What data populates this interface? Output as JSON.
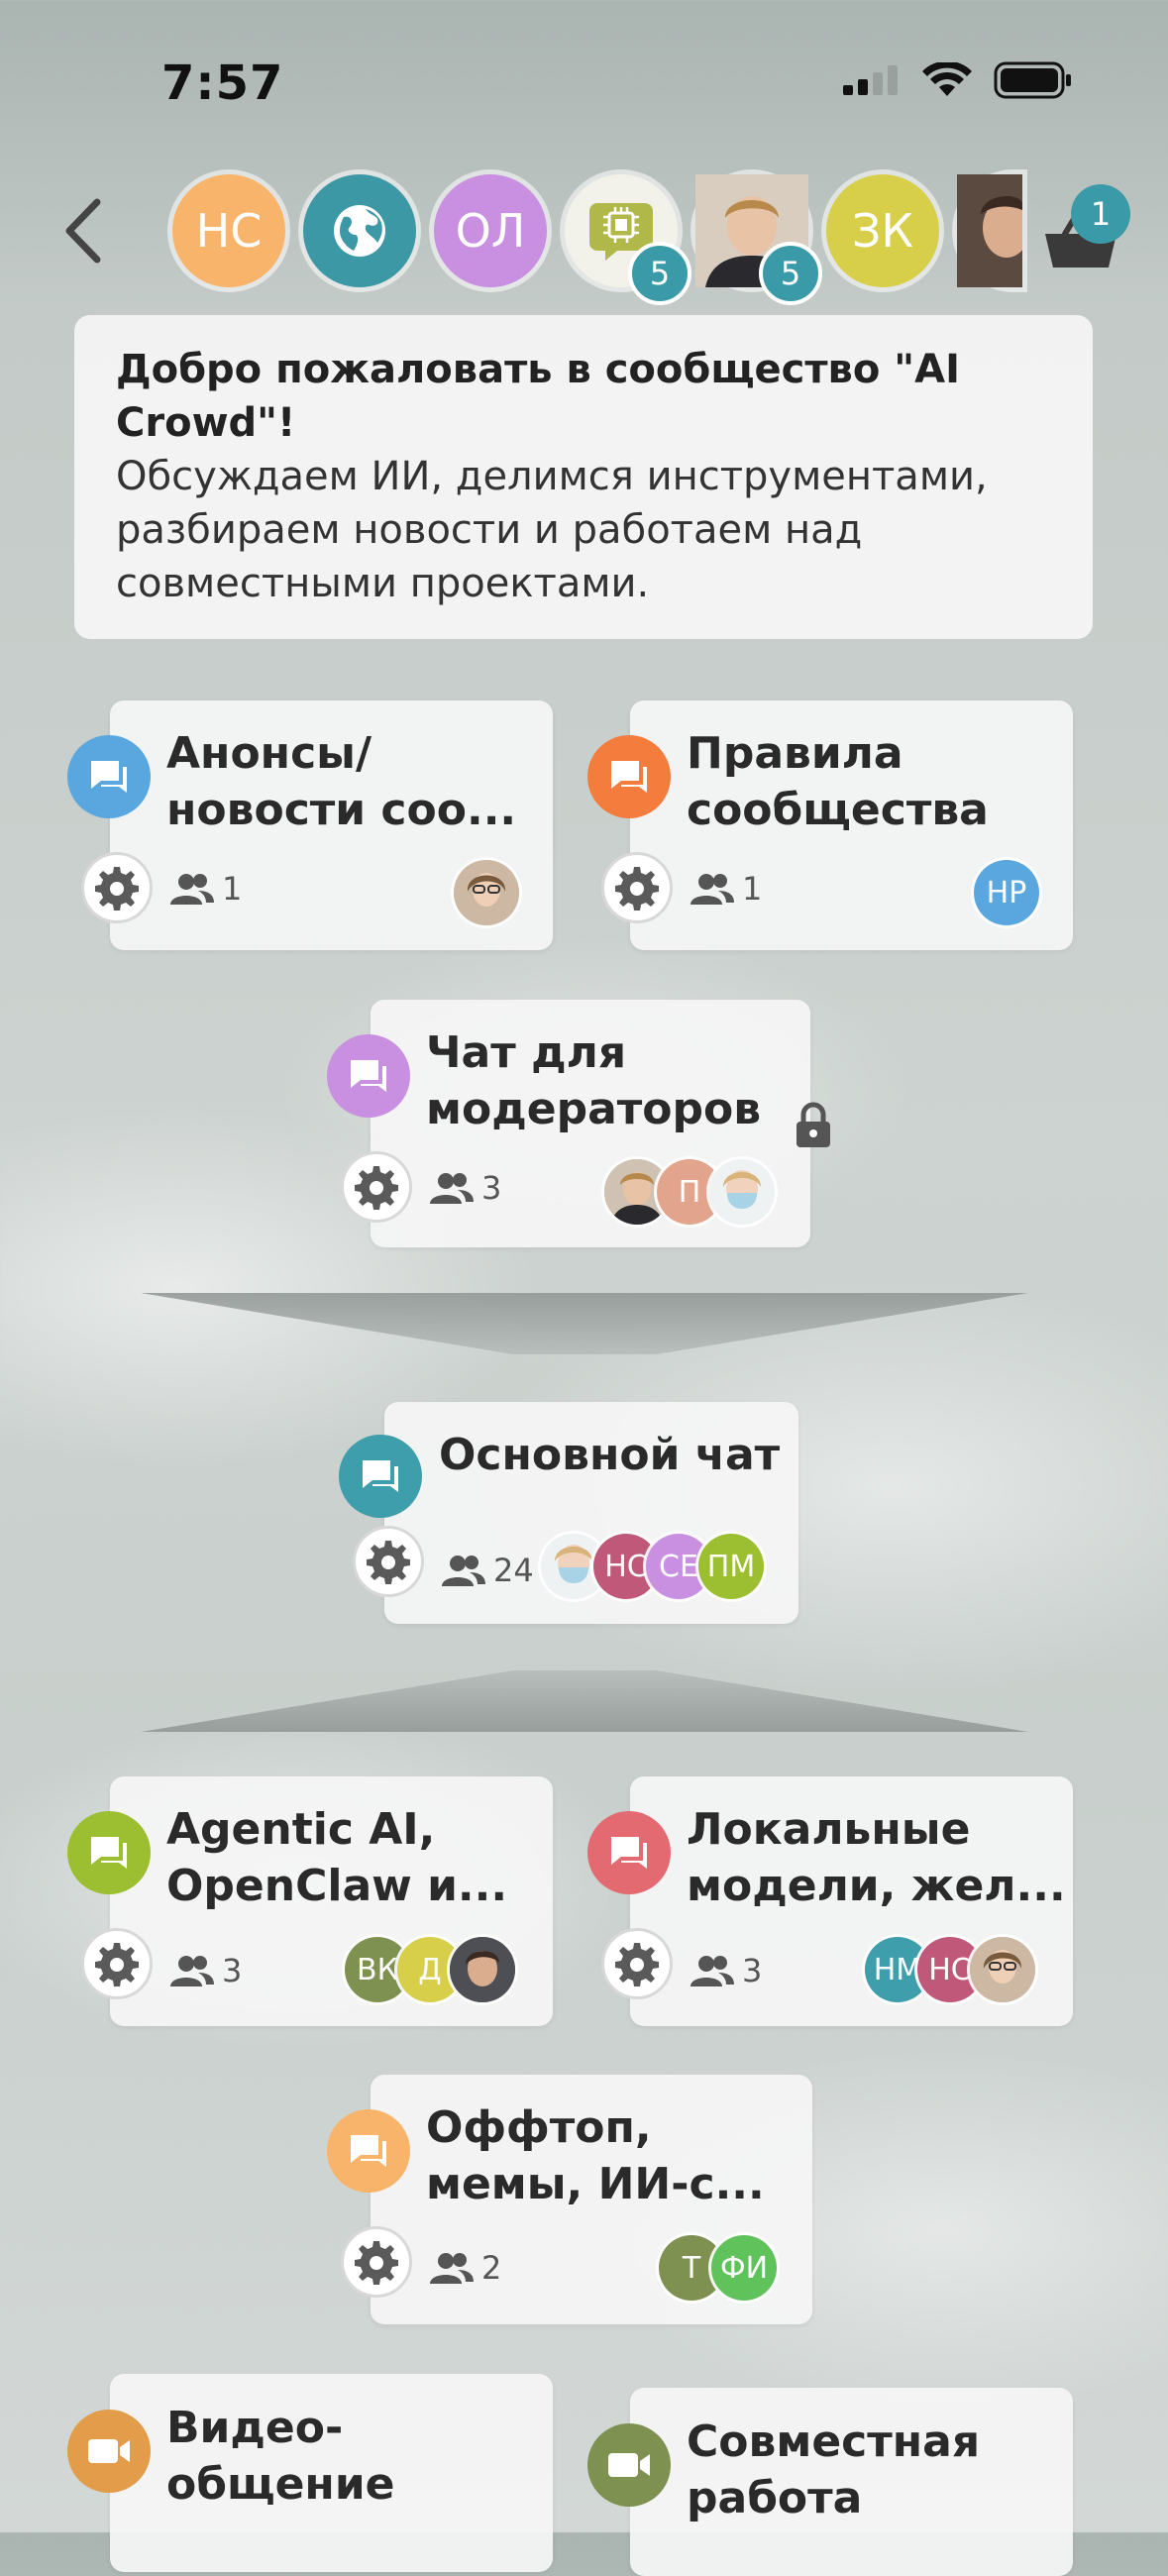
{
  "status_bar": {
    "time": "7:57"
  },
  "top_bar": {
    "chips": [
      {
        "label": "НС",
        "color": "#f9b46b"
      },
      {
        "label": "",
        "color": "#3d98a6",
        "icon": "globe-icon"
      },
      {
        "label": "ОЛ",
        "color": "#c98fe0"
      },
      {
        "label": "",
        "color": "#f2f2ea",
        "icon": "ai-chip-icon",
        "badge": "5"
      },
      {
        "label": "",
        "color": "#c9b9a6",
        "icon": "person-photo",
        "badge": "5"
      },
      {
        "label": "ЗК",
        "color": "#d7cf4a"
      },
      {
        "label": "",
        "color": "#8a7566",
        "icon": "person-photo"
      }
    ],
    "cart_badge": "1"
  },
  "welcome": {
    "title": "Добро пожаловать в сообщество \"AI Crowd\"!",
    "text": "Обсуждаем ИИ, делимся инструментами, разбираем новости и работаем над совместными проектами."
  },
  "channels": {
    "announcements": {
      "title_line1": "Анонсы/",
      "title_line2": "новости соо...",
      "members": "1",
      "icon_color": "#5aa7e0"
    },
    "rules": {
      "title_line1": "Правила",
      "title_line2": "сообщества",
      "members": "1",
      "icon_color": "#f47d3e",
      "avatar": "НР"
    },
    "moderators": {
      "title_line1": "Чат для",
      "title_line2": "модераторов",
      "members": "3",
      "icon_color": "#c98fe0",
      "avatar_p": "П"
    },
    "main": {
      "title": "Основной чат",
      "members": "24",
      "icon_color": "#3f9eab",
      "avatars": [
        "НС",
        "СЕ",
        "ПМ"
      ]
    },
    "agentic": {
      "title_line1": "Agentic AI,",
      "title_line2": "OpenClaw и...",
      "members": "3",
      "icon_color": "#9bbf30",
      "avatars": [
        "ВК",
        "Д"
      ]
    },
    "local": {
      "title_line1": "Локальные",
      "title_line2": "модели, жел...",
      "members": "3",
      "icon_color": "#e46a72",
      "avatars": [
        "НМ",
        "НС"
      ]
    },
    "offtopic": {
      "title_line1": "Оффтоп,",
      "title_line2": "мемы, ИИ-с...",
      "members": "2",
      "icon_color": "#f9b46b",
      "avatars": [
        "Т",
        "ФИ"
      ]
    },
    "video": {
      "title_line1": "Видео-",
      "title_line2": "общение",
      "icon_color": "#e39c4a"
    },
    "collab": {
      "title_line1": "Совместная",
      "title_line2": "работа",
      "icon_color": "#7e9150"
    }
  }
}
